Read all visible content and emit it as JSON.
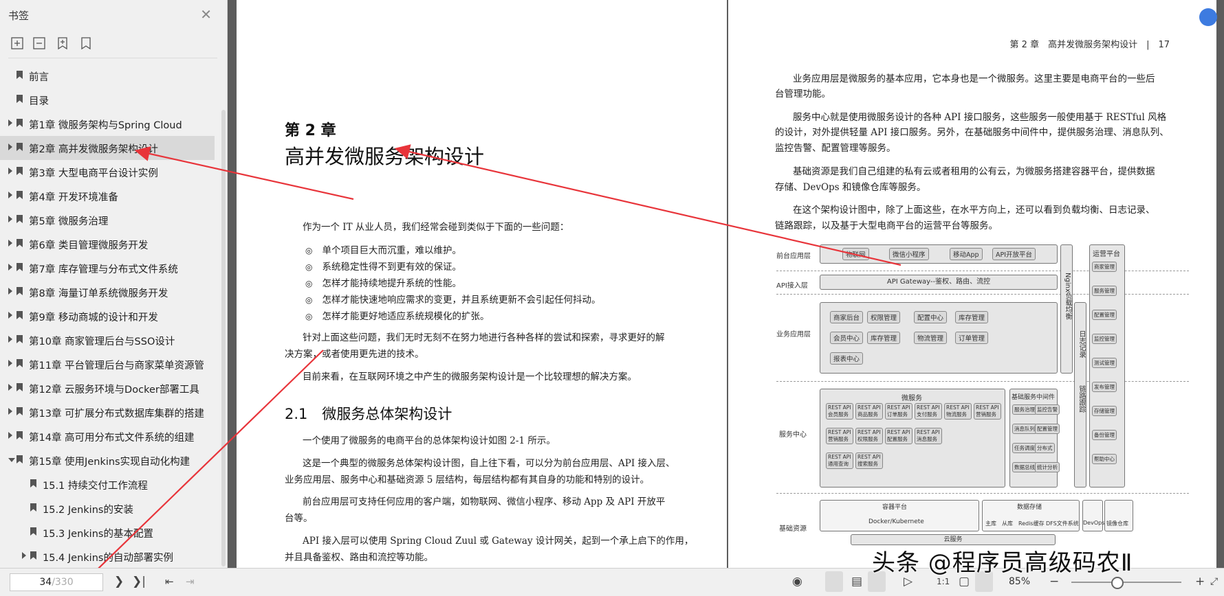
{
  "sidebar": {
    "title": "书签",
    "items": [
      {
        "label": "前言",
        "level": 0,
        "expandable": false,
        "selected": false
      },
      {
        "label": "目录",
        "level": 0,
        "expandable": false,
        "selected": false
      },
      {
        "label": "第1章 微服务架构与Spring Cloud",
        "level": 0,
        "expandable": true,
        "selected": false
      },
      {
        "label": "第2章 高并发微服务架构设计",
        "level": 0,
        "expandable": true,
        "selected": true
      },
      {
        "label": "第3章 大型电商平台设计实例",
        "level": 0,
        "expandable": true,
        "selected": false
      },
      {
        "label": "第4章 开发环境准备",
        "level": 0,
        "expandable": true,
        "selected": false
      },
      {
        "label": "第5章 微服务治理",
        "level": 0,
        "expandable": true,
        "selected": false
      },
      {
        "label": "第6章 类目管理微服务开发",
        "level": 0,
        "expandable": true,
        "selected": false
      },
      {
        "label": "第7章 库存管理与分布式文件系统",
        "level": 0,
        "expandable": true,
        "selected": false
      },
      {
        "label": "第8章 海量订单系统微服务开发",
        "level": 0,
        "expandable": true,
        "selected": false
      },
      {
        "label": "第9章 移动商城的设计和开发",
        "level": 0,
        "expandable": true,
        "selected": false
      },
      {
        "label": "第10章 商家管理后台与SSO设计",
        "level": 0,
        "expandable": true,
        "selected": false
      },
      {
        "label": "第11章 平台管理后台与商家菜单资源管",
        "level": 0,
        "expandable": true,
        "selected": false
      },
      {
        "label": "第12章 云服务环境与Docker部署工具",
        "level": 0,
        "expandable": true,
        "selected": false
      },
      {
        "label": "第13章 可扩展分布式数据库集群的搭建",
        "level": 0,
        "expandable": true,
        "selected": false
      },
      {
        "label": "第14章 高可用分布式文件系统的组建",
        "level": 0,
        "expandable": true,
        "selected": false
      },
      {
        "label": "第15章 使用Jenkins实现自动化构建",
        "level": 0,
        "expandable": true,
        "expanded": true,
        "selected": false
      },
      {
        "label": "15.1 持续交付工作流程",
        "level": 1,
        "expandable": false,
        "selected": false
      },
      {
        "label": "15.2 Jenkins的安装",
        "level": 1,
        "expandable": false,
        "selected": false
      },
      {
        "label": "15.3 Jenkins的基本配置",
        "level": 1,
        "expandable": false,
        "selected": false
      },
      {
        "label": "15.4 Jenkins的自动部署实例",
        "level": 1,
        "expandable": true,
        "selected": false
      }
    ]
  },
  "left_page": {
    "chapter_number": "第 2 章",
    "chapter_title": "高并发微服务架构设计",
    "intro": "作为一个 IT 从业人员，我们经常会碰到类似于下面的一些问题：",
    "bullets": [
      "单个项目巨大而沉重，难以维护。",
      "系统稳定性得不到更有效的保证。",
      "怎样才能持续地提升系统的性能。",
      "怎样才能快速地响应需求的变更，并且系统更新不会引起任何抖动。",
      "怎样才能更好地适应系统规模化的扩张。"
    ],
    "para1_l1": "针对上面这些问题，我们无时无刻不在努力地进行各种各样的尝试和探索，寻求更好的解",
    "para1_l2": "决方案，或者使用更先进的技术。",
    "para2": "目前来看，在互联网环境之中产生的微服务架构设计是一个比较理想的解决方案。",
    "section": "2.1　微服务总体架构设计",
    "para3": "一个使用了微服务的电商平台的总体架构设计如图 2-1 所示。",
    "para4_l1": "这是一个典型的微服务总体架构设计图，自上往下看，可以分为前台应用层、API 接入层、",
    "para4_l2": "业务应用层、服务中心和基础资源 5 层结构，每层结构都有其自身的功能和特别的设计。",
    "para5_l1": "前台应用层可支持任何应用的客户端，如物联网、微信小程序、移动 App 及 API 开放平",
    "para5_l2": "台等。",
    "para6_l1": "API 接入层可以使用 Spring Cloud Zuul 或 Gateway 设计网关，起到一个承上启下的作用，",
    "para6_l2": "并且具备鉴权、路由和流控等功能。"
  },
  "right_page": {
    "running_head": "第 2 章　高并发微服务架构设计　|　17",
    "p1_l1": "业务应用层是微服务的基本应用，它本身也是一个微服务。这里主要是电商平台的一些后",
    "p1_l2": "台管理功能。",
    "p2_l1": "服务中心就是使用微服务设计的各种 API 接口服务，这些服务一般使用基于 RESTful 风格",
    "p2_l2": "的设计，对外提供轻量 API 接口服务。另外，在基础服务中间件中，提供服务治理、消息队列、",
    "p2_l3": "监控告警、配置管理等服务。",
    "p3_l1": "基础资源是我们自己组建的私有云或者租用的公有云，为微服务搭建容器平台，提供数据",
    "p3_l2": "存储、DevOps 和镜像仓库等服务。",
    "p4_l1": "在这个架构设计图中，除了上面这些，在水平方向上，还可以看到负载均衡、日志记录、",
    "p4_l2": "链路跟踪，以及基于大型电商平台的运营平台等服务。",
    "diagram": {
      "layers": [
        "前台应用层",
        "API接入层",
        "业务应用层",
        "服务中心",
        "基础资源"
      ],
      "front": [
        "物联网",
        "微信小程序",
        "移动App",
        "API开放平台"
      ],
      "gateway": "API Gateway--鉴权、路由、流控",
      "biz": [
        "商家后台",
        "权限管理",
        "配置中心",
        "库存管理",
        "会员中心",
        "库存管理",
        "物流管理",
        "订单管理",
        "报表中心"
      ],
      "micro_title": "微服务",
      "middleware_title": "基础服务中间件",
      "rest": "REST API",
      "services": [
        "会员服务",
        "商品服务",
        "订单服务",
        "支付服务",
        "物流服务",
        "营销服务",
        "营销服务",
        "权限服务",
        "配置服务",
        "消息服务",
        "通用查询",
        "搜索服务"
      ],
      "middleware": [
        "服务治理",
        "监控告警",
        "消息队列",
        "配置管理",
        "任务调度",
        "分布式",
        "数据总线",
        "统计分析"
      ],
      "nginx": "Nginx负载均衡",
      "log": "日志记录",
      "trace": "链路跟踪",
      "ops_title": "运营平台",
      "ops": [
        "商家管理",
        "服务管理",
        "配置管理",
        "监控管理",
        "测试管理",
        "发布管理",
        "存储管理",
        "备份管理",
        "帮助中心"
      ],
      "container_title": "容器平台",
      "container": "Docker/Kubernete",
      "storage_title": "数据存储",
      "storage": [
        "主库",
        "从库",
        "Redis缓存",
        "DFS文件系统"
      ],
      "devops": "DevOps",
      "mirror": "镜像仓库",
      "cloud": "云服务"
    }
  },
  "toolbar": {
    "current_page": "34",
    "total_pages": "/330",
    "zoom": "85%"
  },
  "watermark": "头条 @程序员高级码农Ⅱ",
  "colors": {
    "arrow": "#e8343a",
    "accent": "#3d7be0",
    "selection": "#d9d9d9"
  }
}
